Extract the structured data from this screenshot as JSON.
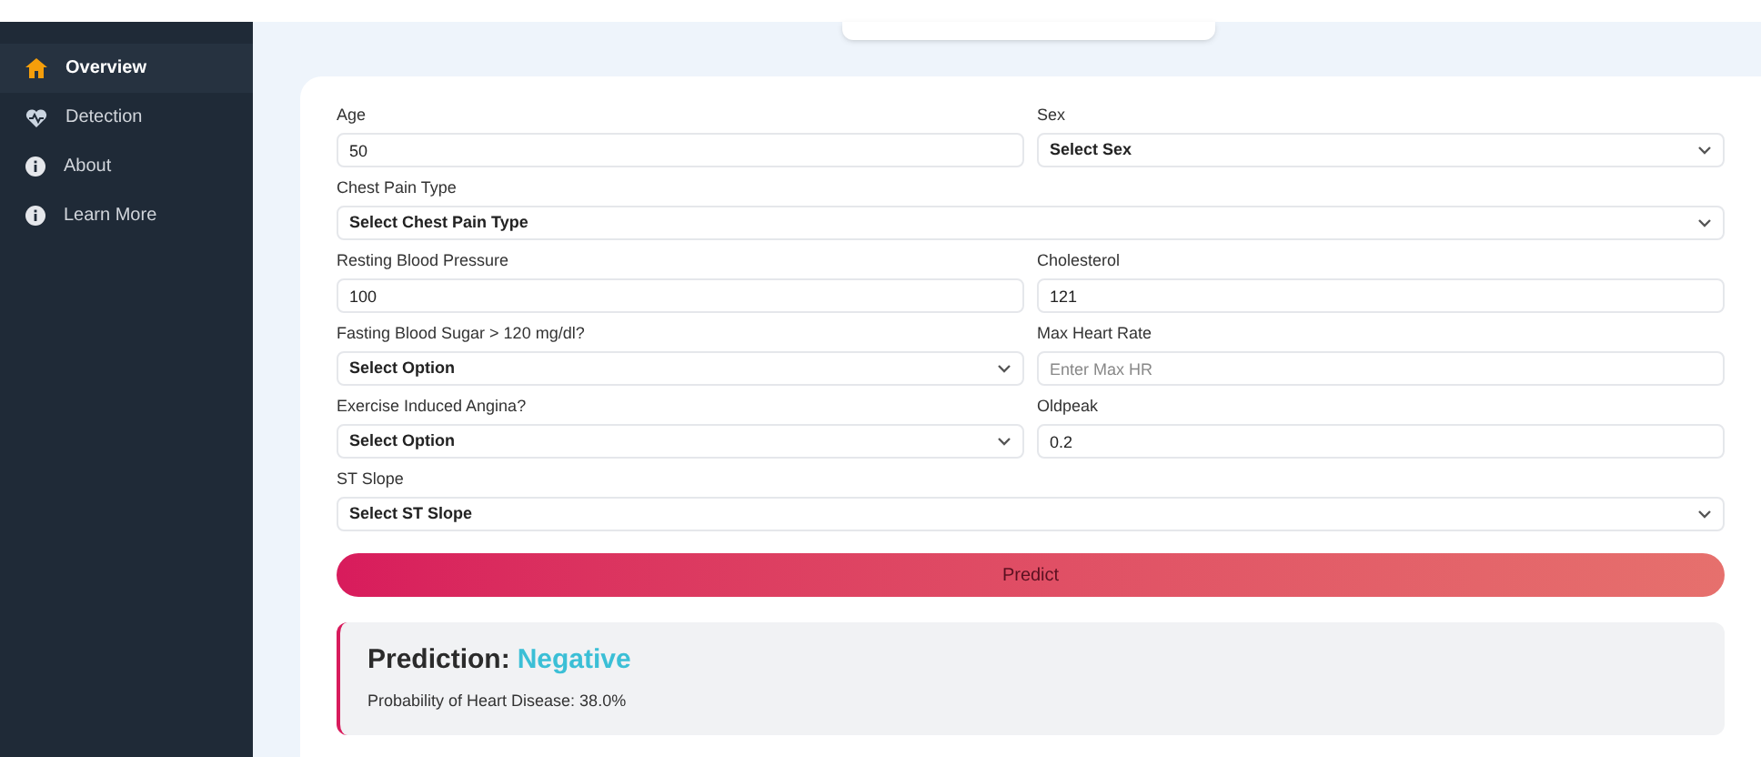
{
  "sidebar": {
    "items": [
      {
        "label": "Overview",
        "selected": true
      },
      {
        "label": "Detection",
        "selected": false
      },
      {
        "label": "About",
        "selected": false
      },
      {
        "label": "Learn More",
        "selected": false
      }
    ]
  },
  "form": {
    "rows": [
      [
        {
          "label": "Age",
          "kind": "input",
          "value": "50"
        },
        {
          "label": "Sex",
          "kind": "select",
          "value": "Select Sex"
        }
      ],
      [
        {
          "label": "Chest Pain Type",
          "kind": "select",
          "value": "Select Chest Pain Type"
        }
      ],
      [
        {
          "label": "Resting Blood Pressure",
          "kind": "input",
          "value": "100"
        },
        {
          "label": "Cholesterol",
          "kind": "input",
          "value": "121"
        }
      ],
      [
        {
          "label": "Fasting Blood Sugar > 120 mg/dl?",
          "kind": "select",
          "value": "Select Option"
        },
        {
          "label": "Max Heart Rate",
          "kind": "input",
          "placeholder": "Enter Max HR"
        }
      ],
      [
        {
          "label": "Exercise Induced Angina?",
          "kind": "select",
          "value": "Select Option"
        },
        {
          "label": "Oldpeak",
          "kind": "input",
          "value": "0.2"
        }
      ],
      [
        {
          "label": "ST Slope",
          "kind": "select",
          "value": "Select ST Slope"
        }
      ]
    ],
    "submit": "Predict"
  },
  "result": {
    "heading": "Prediction:",
    "outcome": "Negative",
    "detail": "Probability of Heart Disease: 38.0%"
  }
}
